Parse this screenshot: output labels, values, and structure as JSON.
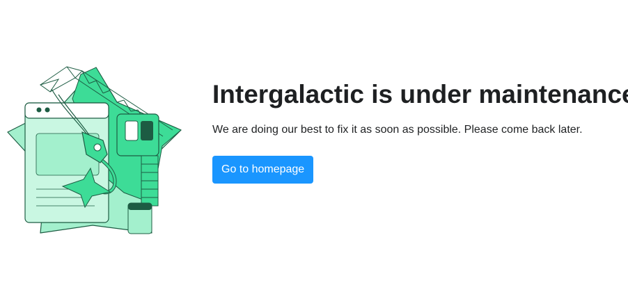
{
  "maintenance": {
    "title": "Intergalactic is under maintenance",
    "message": "We are doing our best to fix it as soon as possible. Please come back later.",
    "button_label": "Go to homepage"
  },
  "colors": {
    "accent": "#1a96ff",
    "illustration_green": "#3ddc97",
    "illustration_light": "#a3f0cd",
    "illustration_stroke": "#1d5c43"
  },
  "illustration": {
    "icon": "maintenance-crane-star-icon"
  }
}
